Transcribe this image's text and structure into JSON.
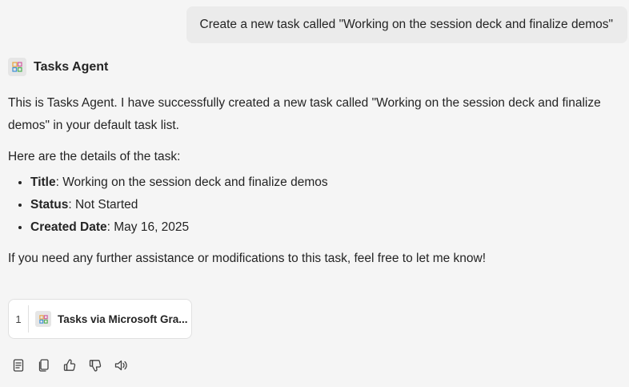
{
  "user_message": {
    "text": "Create a new task called \"Working on the session deck and finalize demos\""
  },
  "agent": {
    "name": "Tasks Agent",
    "icon": "tasks-app-icon"
  },
  "response": {
    "intro": "This is Tasks Agent. I have successfully created a new task called \"Working on the session deck and finalize demos\" in your default task list.",
    "details_heading": "Here are the details of the task:",
    "details": [
      {
        "label": "Title",
        "value": ": Working on the session deck and finalize demos"
      },
      {
        "label": "Status",
        "value": ": Not Started"
      },
      {
        "label": "Created Date",
        "value": ": May 16, 2025"
      }
    ],
    "closing": "If you need any further assistance or modifications to this task, feel free to let me know!"
  },
  "citation": {
    "number": "1",
    "label": "Tasks via Microsoft Gra...",
    "icon": "tasks-app-icon"
  },
  "toolbar": {
    "icons": [
      "notes-icon",
      "copy-icon",
      "thumbs-up-icon",
      "thumbs-down-icon",
      "speaker-icon"
    ]
  }
}
